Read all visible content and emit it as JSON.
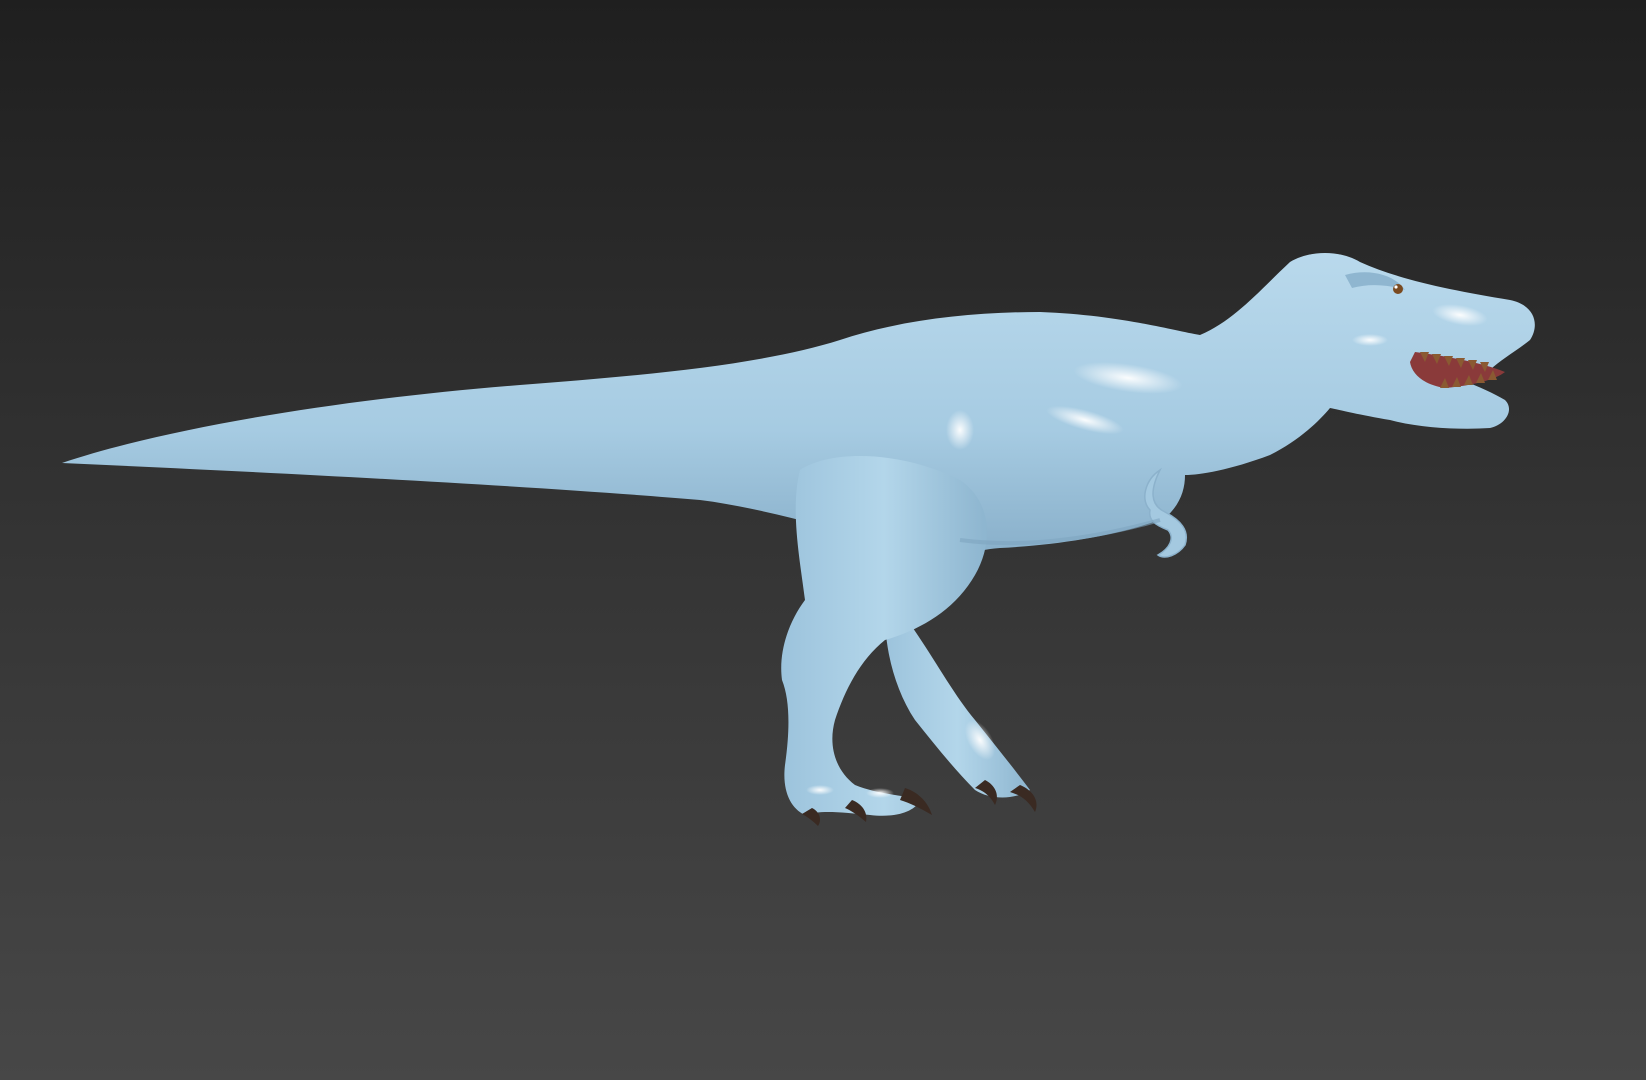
{
  "viewport": {
    "label": "",
    "background_top": "#1f1f1f",
    "background_bottom": "#474747"
  },
  "model": {
    "name": "",
    "material_color": "#a9cde4",
    "shadow_color": "#7fa8c2",
    "highlight_color": "#eef7fc",
    "claw_color": "#3a2a22",
    "mouth_color": "#8a3a3a",
    "teeth_color": "#8a5a32",
    "eye_color": "#7a4a20"
  }
}
